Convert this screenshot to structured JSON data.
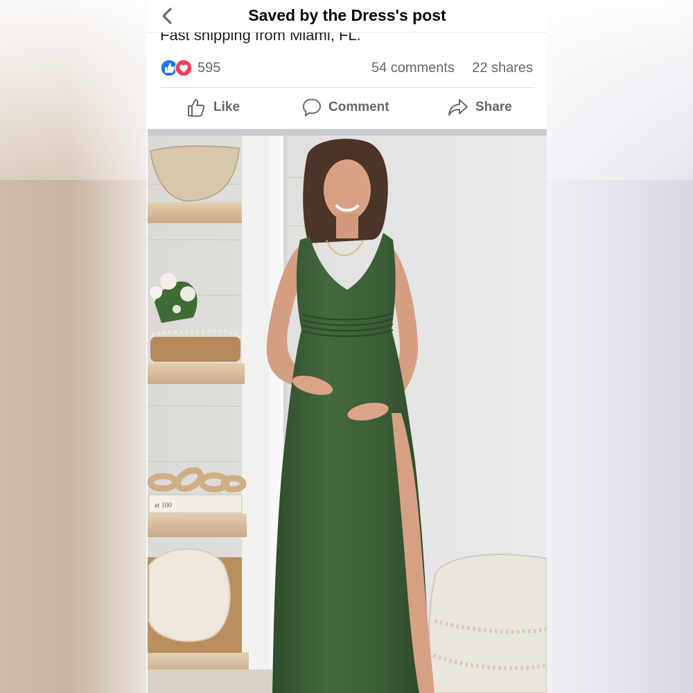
{
  "header": {
    "title": "Saved by the Dress's post",
    "back_icon": "chevron-left-icon"
  },
  "post": {
    "partial_text": "Fast shipping from Miami, FL."
  },
  "stats": {
    "reaction_icons": [
      "like-reaction-icon",
      "love-reaction-icon"
    ],
    "reaction_count": "595",
    "comments": "54 comments",
    "shares": "22 shares"
  },
  "actions": {
    "like": "Like",
    "comment": "Comment",
    "share": "Share"
  },
  "photo": {
    "book_spine_text": "at 100"
  },
  "colors": {
    "like_blue": "#1877f2",
    "love_red": "#f33e58",
    "dress_green": "#3d6138",
    "secondary_text": "#65676b"
  }
}
